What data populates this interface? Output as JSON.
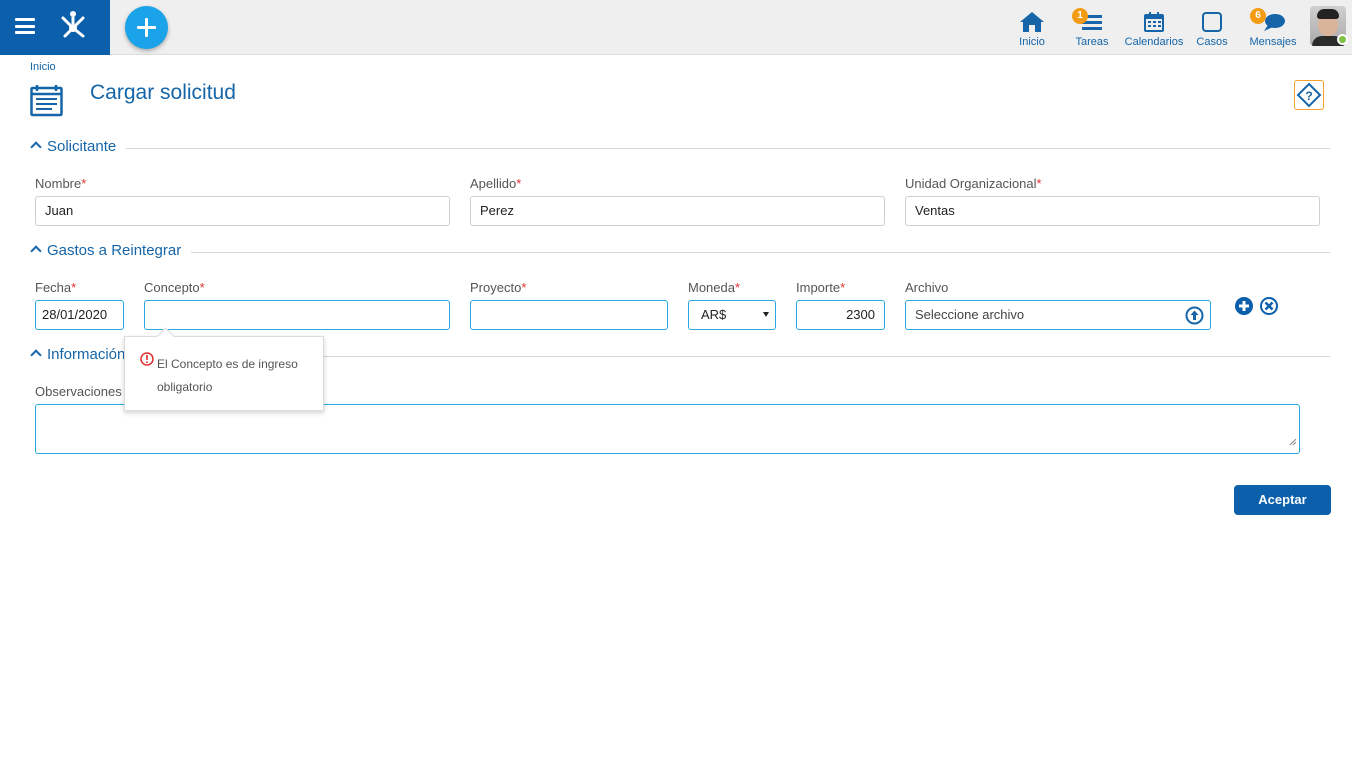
{
  "header": {
    "nav": [
      {
        "label": "Inicio",
        "icon": "home-icon"
      },
      {
        "label": "Tareas",
        "icon": "tasks-icon",
        "badge": "1"
      },
      {
        "label": "Calendarios",
        "icon": "calendar-icon"
      },
      {
        "label": "Casos",
        "icon": "cases-icon"
      },
      {
        "label": "Mensajes",
        "icon": "messages-icon",
        "badge": "6"
      }
    ],
    "accent_color": "#0b5fab",
    "add_button_color": "#1aa3e8",
    "badge_color": "#f39c12"
  },
  "breadcrumb": "Inicio",
  "page": {
    "title": "Cargar solicitud"
  },
  "sections": {
    "solicitante": {
      "title": "Solicitante",
      "nombre": {
        "label": "Nombre",
        "value": "Juan",
        "required": "*"
      },
      "apellido": {
        "label": "Apellido",
        "value": "Perez",
        "required": "*"
      },
      "unidad": {
        "label": "Unidad Organizacional",
        "value": "Ventas",
        "required": "*"
      }
    },
    "gastos": {
      "title": "Gastos a Reintegrar",
      "fecha": {
        "label": "Fecha",
        "value": "28/01/2020",
        "required": "*"
      },
      "concepto": {
        "label": "Concepto",
        "value": "",
        "required": "*"
      },
      "proyecto": {
        "label": "Proyecto",
        "value": "",
        "required": "*"
      },
      "moneda": {
        "label": "Moneda",
        "value": "AR$",
        "required": "*"
      },
      "importe": {
        "label": "Importe",
        "value": "2300",
        "required": "*"
      },
      "archivo": {
        "label": "Archivo",
        "placeholder": "Seleccione archivo"
      }
    },
    "informacion": {
      "title": "Información",
      "observaciones": {
        "label": "Observaciones",
        "value": ""
      }
    }
  },
  "tooltip": {
    "message": "El Concepto es de ingreso obligatorio",
    "error_color": "#e0302f"
  },
  "actions": {
    "accept_label": "Aceptar"
  }
}
